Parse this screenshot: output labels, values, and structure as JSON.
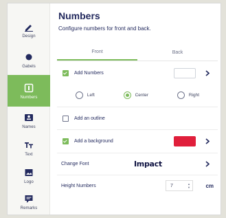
{
  "sidebar": {
    "items": [
      {
        "label": "Design",
        "icon": "pen-icon"
      },
      {
        "label": "Gabels",
        "icon": "circle-icon"
      },
      {
        "label": "Numbers",
        "icon": "numbers-icon",
        "active": true
      },
      {
        "label": "Names",
        "icon": "user-card-icon"
      },
      {
        "label": "Text",
        "icon": "text-icon"
      },
      {
        "label": "Logo",
        "icon": "image-icon"
      },
      {
        "label": "Remarks",
        "icon": "comment-icon"
      }
    ]
  },
  "header": {
    "title": "Numbers",
    "subtitle": "Configure numbers for front and back."
  },
  "tabs": [
    {
      "label": "Front",
      "active": true
    },
    {
      "label": "Back",
      "active": false
    }
  ],
  "options": {
    "add_numbers": {
      "label": "Add Numbers",
      "checked": true,
      "color": "#ffffff"
    },
    "alignment": {
      "options": [
        "Left",
        "Center",
        "Right"
      ],
      "selected": "Center"
    },
    "add_outline": {
      "label": "Add an outline",
      "checked": false
    },
    "add_background": {
      "label": "Add a background",
      "checked": true,
      "color": "#e01f3b"
    },
    "change_font": {
      "label": "Change Font",
      "font_name": "Impact"
    },
    "height": {
      "label": "Height Numbers",
      "value": "7",
      "unit": "cm"
    }
  },
  "colors": {
    "accent": "#7dbb5b",
    "text": "#232a5e"
  }
}
